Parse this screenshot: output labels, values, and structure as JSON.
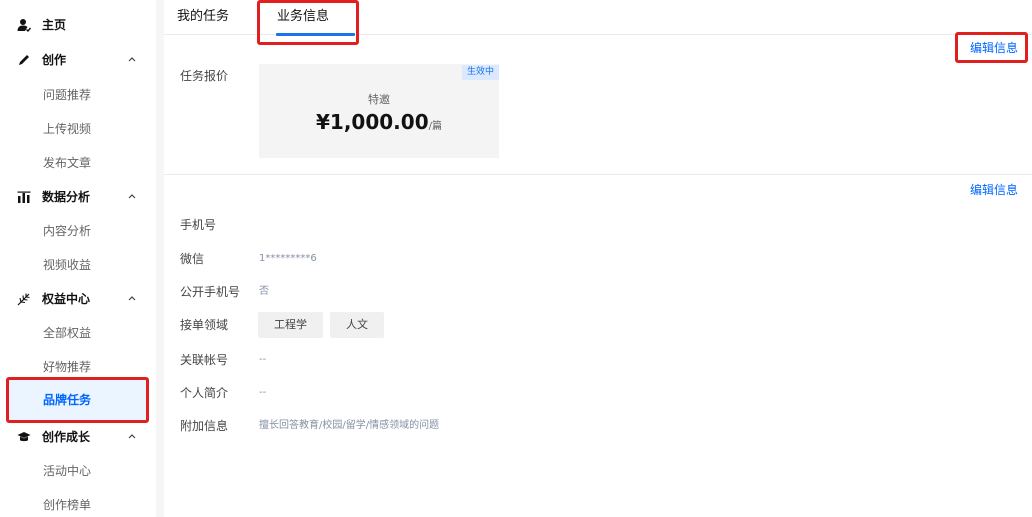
{
  "sidebar": {
    "home": {
      "label": "主页",
      "icon": "user-icon"
    },
    "create": {
      "label": "创作",
      "icon": "pencil-icon",
      "items": [
        "问题推荐",
        "上传视频",
        "发布文章"
      ]
    },
    "analytics": {
      "label": "数据分析",
      "icon": "bar-chart-icon",
      "items": [
        "内容分析",
        "视频收益"
      ]
    },
    "benefits": {
      "label": "权益中心",
      "icon": "leaf-icon",
      "items": [
        "全部权益",
        "好物推荐",
        "品牌任务"
      ]
    },
    "growth": {
      "label": "创作成长",
      "icon": "graduation-cap-icon",
      "items": [
        "活动中心",
        "创作榜单"
      ]
    }
  },
  "tabs": [
    {
      "label": "我的任务",
      "active": false
    },
    {
      "label": "业务信息",
      "active": true
    }
  ],
  "quote": {
    "label": "任务报价",
    "badge": "生效中",
    "kind": "特邀",
    "amount": "¥1,000.00",
    "unit": "/篇",
    "edit_label": "编辑信息"
  },
  "info": {
    "edit_label": "编辑信息",
    "phone_label": "手机号",
    "wechat_label": "微信",
    "wechat_value": "1*********6",
    "public_phone_label": "公开手机号",
    "public_phone_value": "否",
    "domains_label": "接单领域",
    "domains": [
      "工程学",
      "人文"
    ],
    "linked_label": "关联帐号",
    "linked_value": "--",
    "bio_label": "个人简介",
    "bio_value": "--",
    "extra_label": "附加信息",
    "extra_value": "擅长回答教育/校园/留学/情感领域的问题"
  },
  "colors": {
    "accent": "#0066ff",
    "highlight": "#e02020",
    "active_bg": "#ebf5ff"
  }
}
